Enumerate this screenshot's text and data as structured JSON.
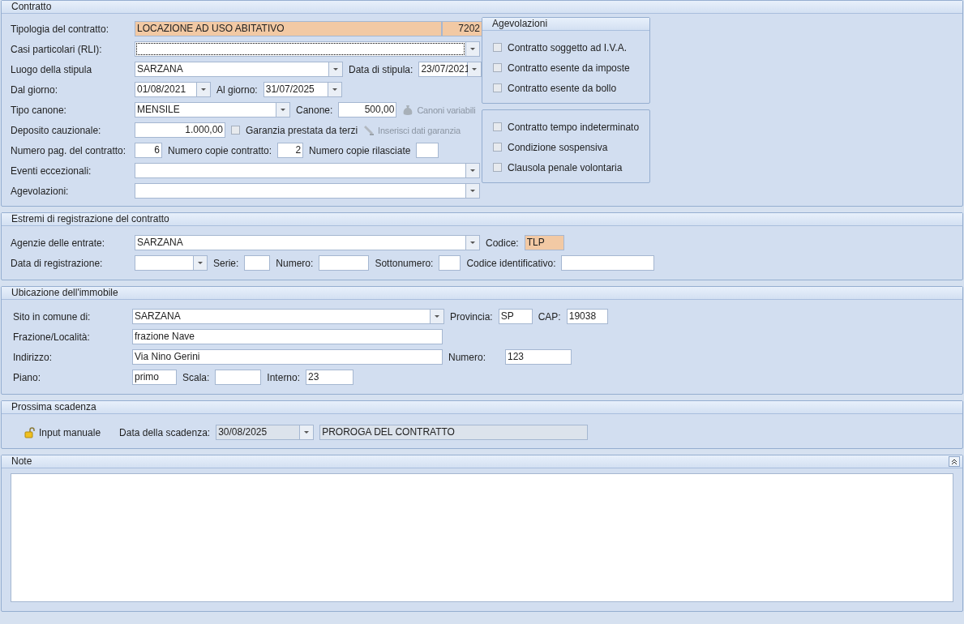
{
  "contratto": {
    "title": "Contratto",
    "tipologia": {
      "label": "Tipologia del contratto:",
      "value": "LOCAZIONE AD USO ABITATIVO",
      "code": "7202",
      "highlighted": true
    },
    "casi_particolari": {
      "label": "Casi particolari (RLI):",
      "focused": true
    },
    "luogo_stipula": {
      "label": "Luogo della stipula",
      "value": "SARZANA"
    },
    "data_stipula": {
      "label": "Data di stipula:",
      "value": "23/07/2021"
    },
    "dal_giorno": {
      "label": "Dal giorno:",
      "value": "01/08/2021"
    },
    "al_giorno": {
      "label": "Al giorno:",
      "value": "31/07/2025"
    },
    "tipo_canone": {
      "label": "Tipo canone:",
      "value": "MENSILE"
    },
    "canone": {
      "label": "Canone:",
      "value": "500,00"
    },
    "canoni_variabili": {
      "label": "Canoni variabili",
      "disabled": true
    },
    "deposito": {
      "label": "Deposito cauzionale:",
      "value": "1.000,00"
    },
    "garanzia_terzi": {
      "label": "Garanzia prestata da terzi",
      "checked": false
    },
    "inserisci_garanzia": {
      "label": "Inserisci dati garanzia",
      "disabled": true
    },
    "numero_pagine": {
      "label": "Numero pag. del contratto:",
      "value": "6"
    },
    "numero_copie": {
      "label": "Numero copie contratto:",
      "value": "2"
    },
    "copie_rilasciate": {
      "label": "Numero copie rilasciate"
    },
    "eventi": {
      "label": "Eventi eccezionali:"
    },
    "agevolazioni": {
      "label": "Agevolazioni:"
    }
  },
  "agevolazioni_group": {
    "title": "Agevolazioni",
    "options": [
      {
        "label": "Contratto soggetto ad I.V.A.",
        "checked": false
      },
      {
        "label": "Contratto esente da imposte",
        "checked": false
      },
      {
        "label": "Contratto esente da bollo",
        "checked": false
      }
    ]
  },
  "other_options": [
    {
      "label": "Contratto tempo indeterminato",
      "checked": false
    },
    {
      "label": "Condizione sospensiva",
      "checked": false
    },
    {
      "label": "Clausola penale volontaria",
      "checked": false
    }
  ],
  "registrazione": {
    "title": "Estremi di registrazione del contratto",
    "agenzia": {
      "label": "Agenzie delle entrate:",
      "value": "SARZANA"
    },
    "codice": {
      "label": "Codice:",
      "value": "TLP",
      "highlighted": true
    },
    "data_registrazione": {
      "label": "Data di registrazione:"
    },
    "serie": {
      "label": "Serie:"
    },
    "numero": {
      "label": "Numero:"
    },
    "sottonumero": {
      "label": "Sottonumero:"
    },
    "codice_identificativo": {
      "label": "Codice identificativo:"
    }
  },
  "ubicazione": {
    "title": "Ubicazione dell'immobile",
    "comune": {
      "label": "Sito in comune di:",
      "value": "SARZANA"
    },
    "provincia": {
      "label": "Provincia:",
      "value": "SP"
    },
    "cap": {
      "label": "CAP:",
      "value": "19038"
    },
    "frazione": {
      "label": "Frazione/Località:",
      "value": "frazione Nave"
    },
    "indirizzo": {
      "label": "Indirizzo:",
      "value": "Via Nino Gerini"
    },
    "numero": {
      "label": "Numero:",
      "value": "123"
    },
    "piano": {
      "label": "Piano:",
      "value": "primo"
    },
    "scala": {
      "label": "Scala:"
    },
    "interno": {
      "label": "Interno:",
      "value": "23"
    }
  },
  "scadenza": {
    "title": "Prossima scadenza",
    "input_manuale": {
      "label": "Input manuale"
    },
    "data": {
      "label": "Data della scadenza:",
      "value": "30/08/2025",
      "disabled": true
    },
    "motivo": {
      "value": "PROROGA DEL CONTRATTO",
      "disabled": true
    }
  },
  "note": {
    "title": "Note",
    "expanded": true
  }
}
